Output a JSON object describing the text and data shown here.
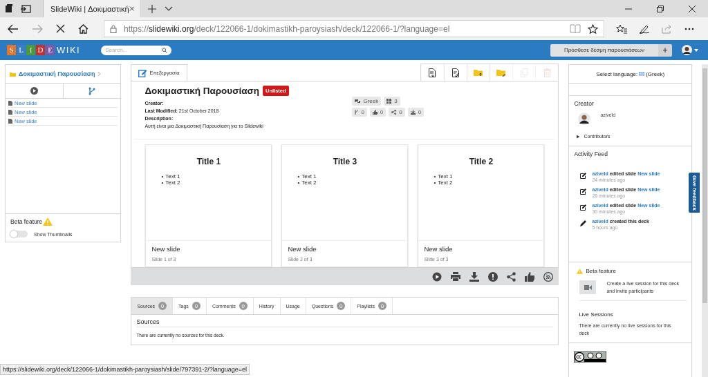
{
  "browser": {
    "tab_title": "SlideWiki | Δοκιμαστική",
    "url": {
      "scheme": "https://",
      "domain": "slidewiki.org",
      "path": "/deck/122066-1/dokimastikh-paroysiash/deck/122066-1/?language=el"
    },
    "status_url": "https://slidewiki.org/deck/122066-1/dokimastikh-paroysiash/slide/797391-2/?language=el"
  },
  "navbar": {
    "logo_letters": [
      "S",
      "L",
      "I",
      "D",
      "E"
    ],
    "logo_plain": "WIKI",
    "search": {
      "placeholder": "Search..."
    },
    "add_button": "Πρόσθεσε δέσμη παρουσιάσεων",
    "add_icon": "+"
  },
  "left_panel": {
    "breadcrumb": "Δοκιμαστική Παρουσίαση",
    "slides": [
      {
        "title": "New slide"
      },
      {
        "title": "New slide"
      },
      {
        "title": "New slide"
      }
    ],
    "beta_label": "Beta feature",
    "thumbnails_toggle": {
      "label": "Show Thumbnails",
      "on": false
    }
  },
  "deck": {
    "tabs": [
      {
        "label": "Επεξεργασία",
        "selected": true
      }
    ],
    "toolbar": [
      {
        "kind": "doc-download",
        "disabled": false
      },
      {
        "kind": "doc-edit",
        "disabled": false
      },
      {
        "kind": "folder-up",
        "disabled": false
      },
      {
        "kind": "folder-edit",
        "disabled": false
      },
      {
        "kind": "copy",
        "disabled": true
      },
      {
        "kind": "delete",
        "disabled": true
      }
    ],
    "title": "Δοκιμαστική Παρουσίαση",
    "badge": "Unlisted",
    "creator_label": "Creator:",
    "modified_label": "Last Modified:",
    "modified_value": "21st October 2018",
    "description_label": "Description:",
    "description": "Αυτή είναι μια Δοκιμαστική Παρουσίαση για το Slidewiki",
    "info_chips": [
      {
        "kind": "language",
        "text": "Greek"
      },
      {
        "kind": "slides",
        "text": "3"
      }
    ],
    "stat_chips": [
      {
        "kind": "forks",
        "text": "0"
      },
      {
        "kind": "likes",
        "text": "0"
      },
      {
        "kind": "shares",
        "text": "0"
      },
      {
        "kind": "downloads",
        "text": "0"
      }
    ],
    "slides": [
      {
        "title": "Title 1",
        "bullets": [
          {
            "marker": "•",
            "text": "Text 1"
          },
          {
            "marker": "•",
            "text": "Text 2"
          }
        ],
        "name": "New slide",
        "position": "Slide 1 of 3"
      },
      {
        "title": "Title 3",
        "bullets": [
          {
            "marker": "•",
            "text": "Text 1"
          },
          {
            "marker": "•",
            "text": "Text 2"
          }
        ],
        "name": "New slide",
        "position": "Slide 2 of 3"
      },
      {
        "title": "Title 2",
        "bullets": [
          {
            "marker": "•",
            "text": "Text 1"
          },
          {
            "marker": "•",
            "text": "Text 2"
          }
        ],
        "name": "New slide",
        "position": "Slide 3 of 3"
      }
    ]
  },
  "details": {
    "tabs": [
      {
        "label": "Sources",
        "count": "0",
        "selected": true
      },
      {
        "label": "Tags",
        "count": "0",
        "selected": false
      },
      {
        "label": "Comments",
        "count": "0",
        "selected": false
      },
      {
        "label": "History",
        "selected": false
      },
      {
        "label": "Usage",
        "selected": false
      },
      {
        "label": "Questions",
        "count": "0",
        "selected": false
      },
      {
        "label": "Playlists",
        "count": "0",
        "selected": false
      }
    ],
    "heading": "Sources",
    "message": "There are currently no sources for this deck."
  },
  "sidebar": {
    "language_label": "Select language:",
    "language": "(Greek)",
    "creator_heading": "Creator",
    "creator_name": "aziveld",
    "contributors": {
      "label": "Contributors",
      "expanded": false
    },
    "activity_heading": "Activity Feed",
    "activity": [
      {
        "kind": "edit",
        "user": "aziveld",
        "action": "edited slide",
        "target": "New slide",
        "time": "24 minutes ago"
      },
      {
        "kind": "edit",
        "user": "aziveld",
        "action": "edited slide",
        "target": "New slide",
        "time": "26 minutes ago"
      },
      {
        "kind": "edit",
        "user": "aziveld",
        "action": "edited slide",
        "target": "New slide",
        "time": "30 minutes ago"
      },
      {
        "kind": "create",
        "user": "aziveld",
        "action": "created this deck",
        "time": "5 hours ago"
      }
    ],
    "beta_label": "Beta feature",
    "live_prompt": "Create a live session for this deck and invite participants",
    "live_heading": "Live Sessions",
    "live_message": "There are currently no live sessions for this deck"
  },
  "feedback_tab": "Give feedback"
}
